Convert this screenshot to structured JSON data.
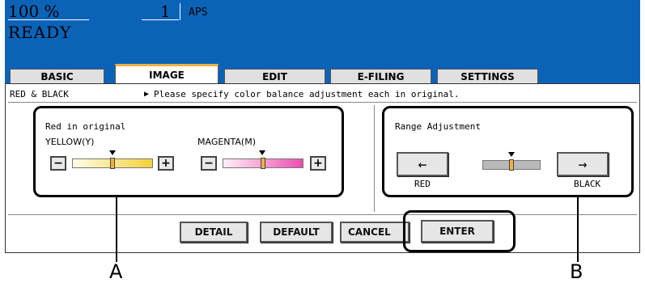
{
  "status": {
    "zoom": "100  %",
    "copies": "1",
    "paper_mode": "APS",
    "state": "READY"
  },
  "tabs": [
    {
      "label": "BASIC",
      "active": false
    },
    {
      "label": "IMAGE",
      "active": true
    },
    {
      "label": "EDIT",
      "active": false
    },
    {
      "label": "E-FILING",
      "active": false
    },
    {
      "label": "SETTINGS",
      "active": false
    }
  ],
  "breadcrumb": "RED & BLACK",
  "message": "Please specify color balance adjustment each in original.",
  "red_panel": {
    "title": "Red in original",
    "yellow": {
      "label": "YELLOW(Y)",
      "minus": "−",
      "plus": "+",
      "level": 0.5
    },
    "magenta": {
      "label": "MAGENTA(M)",
      "minus": "−",
      "plus": "+",
      "level": 0.5
    }
  },
  "range_panel": {
    "title": "Range Adjustment",
    "left_label": "RED",
    "right_label": "BLACK",
    "left_arrow": "←",
    "right_arrow": "→",
    "level": 0.5
  },
  "footer_buttons": {
    "detail": "DETAIL",
    "default": "DEFAULT",
    "cancel": "CANCEL",
    "enter": "ENTER"
  },
  "callouts": {
    "a": "A",
    "b": "B"
  },
  "colors": {
    "status_bg": "#0b63b8",
    "tab_active_accent": "#f0b040",
    "yellow_slider": "#f3d23a",
    "magenta_slider": "#ea4fb0"
  }
}
